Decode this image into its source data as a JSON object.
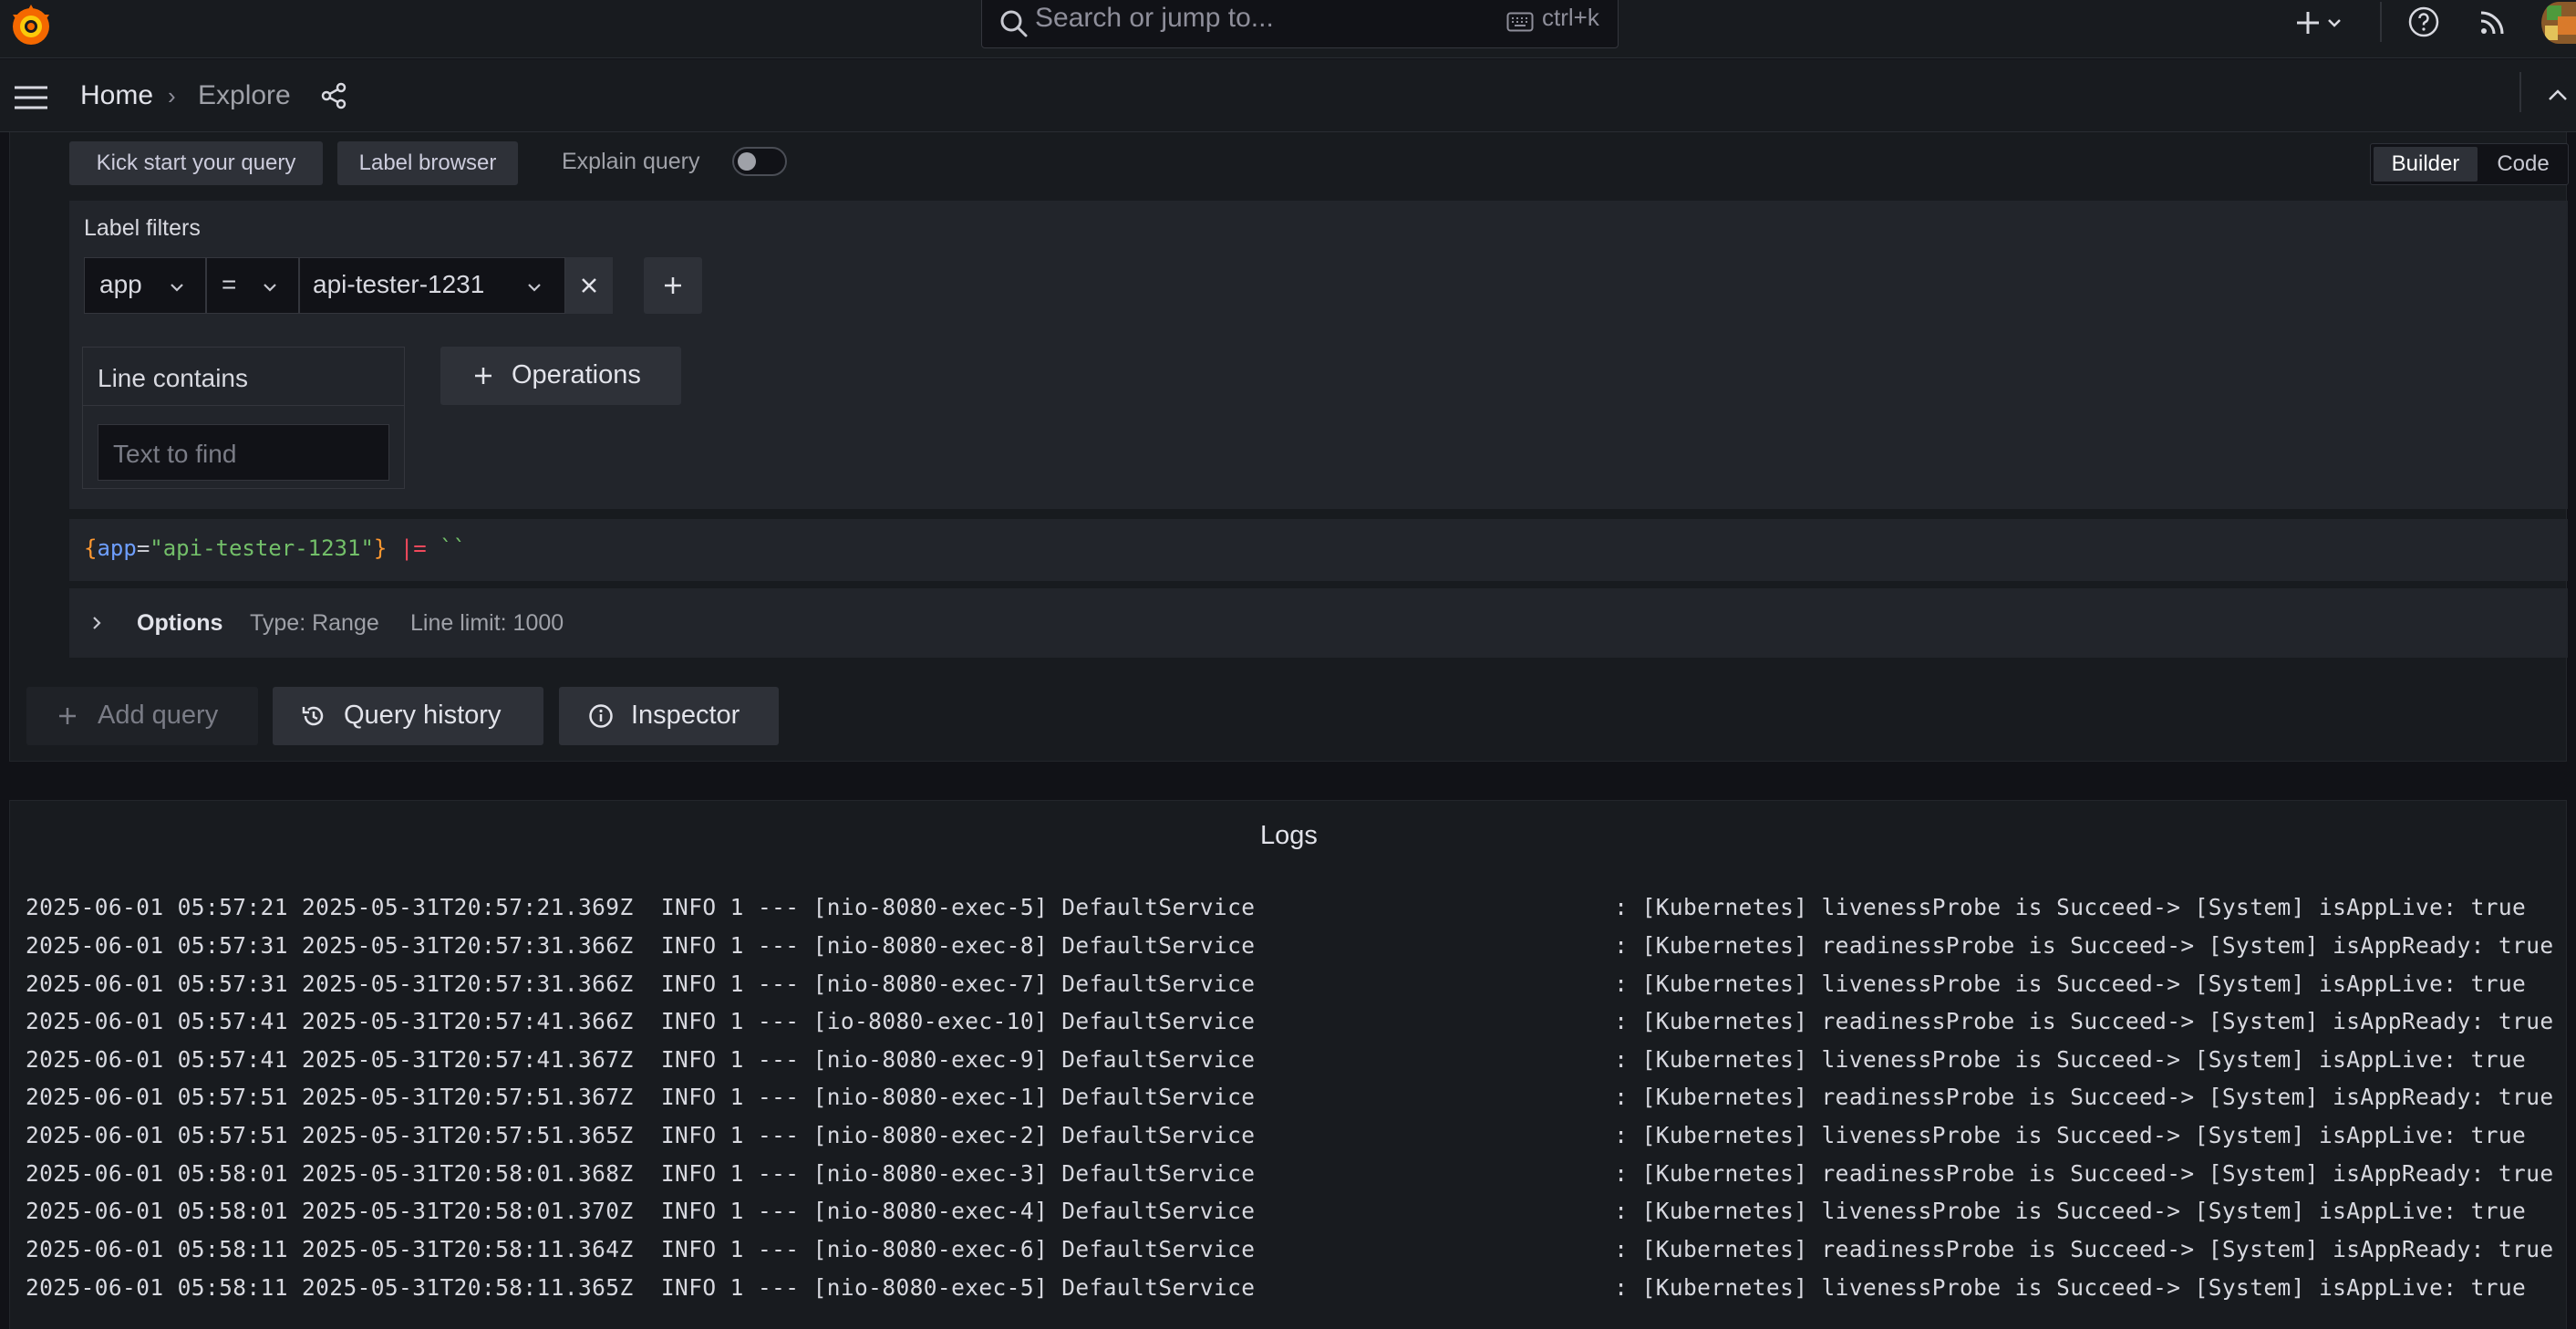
{
  "search": {
    "placeholder": "Search or jump to...",
    "shortcut": "ctrl+k"
  },
  "breadcrumb": {
    "home": "Home",
    "current": "Explore"
  },
  "query": {
    "kick_start_label": "Kick start your query",
    "label_browser_label": "Label browser",
    "explain_query_label": "Explain query",
    "explain_query_on": false,
    "mode_builder": "Builder",
    "mode_code": "Code",
    "active_mode": "Builder",
    "label_filters_title": "Label filters",
    "filter": {
      "label": "app",
      "operator": "=",
      "value": "api-tester-1231"
    },
    "operation": {
      "title": "Line contains",
      "placeholder": "Text to find"
    },
    "operations_label": "Operations",
    "code": {
      "open": "{",
      "label": "app",
      "eq": "=",
      "value": "\"api-tester-1231\"",
      "close": "}",
      "pipe": "|=",
      "backticks": "``"
    },
    "options": {
      "title": "Options",
      "type": "Type: Range",
      "line_limit": "Line limit: 1000"
    }
  },
  "actions": {
    "add_query": "Add query",
    "query_history": "Query history",
    "inspector": "Inspector"
  },
  "logs": {
    "title": "Logs",
    "lines": [
      "2025-06-01 05:57:21 2025-05-31T20:57:21.369Z  INFO 1 --- [nio-8080-exec-5] DefaultService                          : [Kubernetes] livenessProbe is Succeed-> [System] isAppLive: true",
      "2025-06-01 05:57:31 2025-05-31T20:57:31.366Z  INFO 1 --- [nio-8080-exec-8] DefaultService                          : [Kubernetes] readinessProbe is Succeed-> [System] isAppReady: true",
      "2025-06-01 05:57:31 2025-05-31T20:57:31.366Z  INFO 1 --- [nio-8080-exec-7] DefaultService                          : [Kubernetes] livenessProbe is Succeed-> [System] isAppLive: true",
      "2025-06-01 05:57:41 2025-05-31T20:57:41.366Z  INFO 1 --- [io-8080-exec-10] DefaultService                          : [Kubernetes] readinessProbe is Succeed-> [System] isAppReady: true",
      "2025-06-01 05:57:41 2025-05-31T20:57:41.367Z  INFO 1 --- [nio-8080-exec-9] DefaultService                          : [Kubernetes] livenessProbe is Succeed-> [System] isAppLive: true",
      "2025-06-01 05:57:51 2025-05-31T20:57:51.367Z  INFO 1 --- [nio-8080-exec-1] DefaultService                          : [Kubernetes] readinessProbe is Succeed-> [System] isAppReady: true",
      "2025-06-01 05:57:51 2025-05-31T20:57:51.365Z  INFO 1 --- [nio-8080-exec-2] DefaultService                          : [Kubernetes] livenessProbe is Succeed-> [System] isAppLive: true",
      "2025-06-01 05:58:01 2025-05-31T20:58:01.368Z  INFO 1 --- [nio-8080-exec-3] DefaultService                          : [Kubernetes] readinessProbe is Succeed-> [System] isAppReady: true",
      "2025-06-01 05:58:01 2025-05-31T20:58:01.370Z  INFO 1 --- [nio-8080-exec-4] DefaultService                          : [Kubernetes] livenessProbe is Succeed-> [System] isAppLive: true",
      "2025-06-01 05:58:11 2025-05-31T20:58:11.364Z  INFO 1 --- [nio-8080-exec-6] DefaultService                          : [Kubernetes] readinessProbe is Succeed-> [System] isAppReady: true",
      "2025-06-01 05:58:11 2025-05-31T20:58:11.365Z  INFO 1 --- [nio-8080-exec-5] DefaultService                          : [Kubernetes] livenessProbe is Succeed-> [System] isAppLive: true"
    ]
  },
  "colors": {
    "accent_orange": "#f79520",
    "code_brace": "#ff9830",
    "code_label": "#6e9fff",
    "code_value": "#73bf69",
    "code_pipe": "#f2495c"
  },
  "icons": [
    "grafana-logo",
    "search-icon",
    "keyboard-icon",
    "plus-icon",
    "chevron-down-icon",
    "help-icon",
    "rss-icon",
    "avatar",
    "menu-icon",
    "share-icon",
    "chevron-up-icon",
    "close-icon",
    "chevron-right-icon",
    "history-icon",
    "info-icon"
  ]
}
